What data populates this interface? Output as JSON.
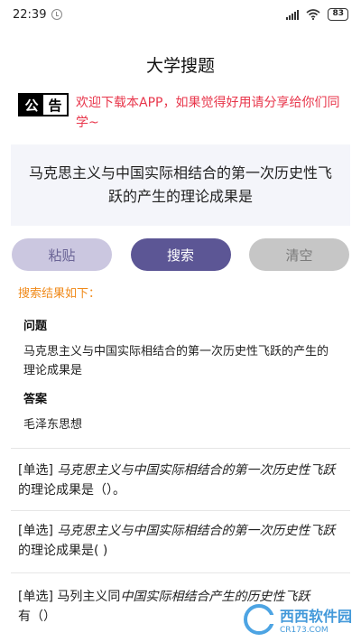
{
  "status_bar": {
    "time": "22:39",
    "battery": "83"
  },
  "title": "大学搜题",
  "notice": {
    "badge_left": "公",
    "badge_right": "告",
    "text": "欢迎下载本APP，如果觉得好用请分享给你们同学~"
  },
  "question": "马克思主义与中国实际相结合的第一次历史性飞跃的产生的理论成果是",
  "buttons": {
    "paste": "粘贴",
    "search": "搜索",
    "clear": "清空"
  },
  "result_label": "搜索结果如下：",
  "answer": {
    "question_heading": "问题",
    "question_text": "马克思主义与中国实际相结合的第一次历史性飞跃的产生的理论成果是",
    "answer_heading": "答案",
    "answer_text": "毛泽东思想"
  },
  "results": [
    {
      "tag": "[单选]",
      "kw": "马克思主义与中国实际相结合的第一次历史性飞跃",
      "rest": "的理论成果是（）。"
    },
    {
      "tag": "[单选]",
      "kw": "马克思主义与中国实际相结合的第一次历史性飞跃",
      "rest": "的理论成果是( )"
    },
    {
      "tag": "[单选]",
      "pre": "马列主义同",
      "kw": "中国实际相结合产生的历史性飞跃",
      "rest": "有（）"
    }
  ],
  "watermark": {
    "main": "西西软件园",
    "sub": "CR173.COM"
  },
  "colors": {
    "accent": "#5c5695",
    "notice": "#e8364b",
    "result_label": "#f08a1a"
  }
}
